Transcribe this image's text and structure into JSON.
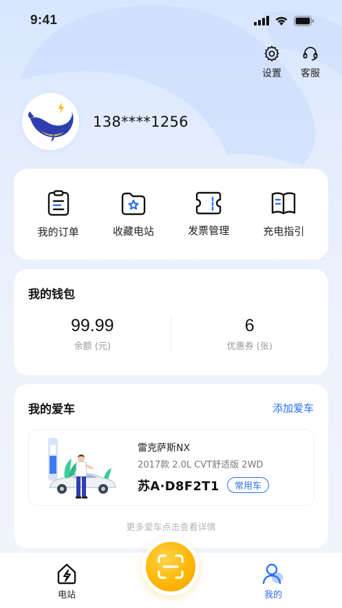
{
  "status_bar": {
    "time": "9:41"
  },
  "header": {
    "settings_label": "设置",
    "service_label": "客服"
  },
  "profile": {
    "phone": "138****1256"
  },
  "quick_actions": [
    {
      "label": "我的订单",
      "icon": "order-icon"
    },
    {
      "label": "收藏电站",
      "icon": "favorite-folder-icon"
    },
    {
      "label": "发票管理",
      "icon": "invoice-icon"
    },
    {
      "label": "充电指引",
      "icon": "guide-book-icon"
    }
  ],
  "wallet": {
    "title": "我的钱包",
    "balance_value": "99.99",
    "balance_label": "余额 (元)",
    "coupon_value": "6",
    "coupon_label": "优惠券 (张)"
  },
  "cars": {
    "title": "我的爱车",
    "add_label": "添加爱车",
    "car": {
      "name": "雷克萨斯NX",
      "spec": "2017款 2.0L CVT舒适版 2WD",
      "plate": "苏A·D8F2T1",
      "badge": "常用车"
    },
    "more_hint": "更多爱车点击查看详情"
  },
  "tabbar": {
    "station_label": "电站",
    "mine_label": "我的",
    "scan_icon": "scan-icon"
  },
  "colors": {
    "accent": "#2a6ef5",
    "scan_button": "#ffb400",
    "background": "#e6eefc"
  }
}
